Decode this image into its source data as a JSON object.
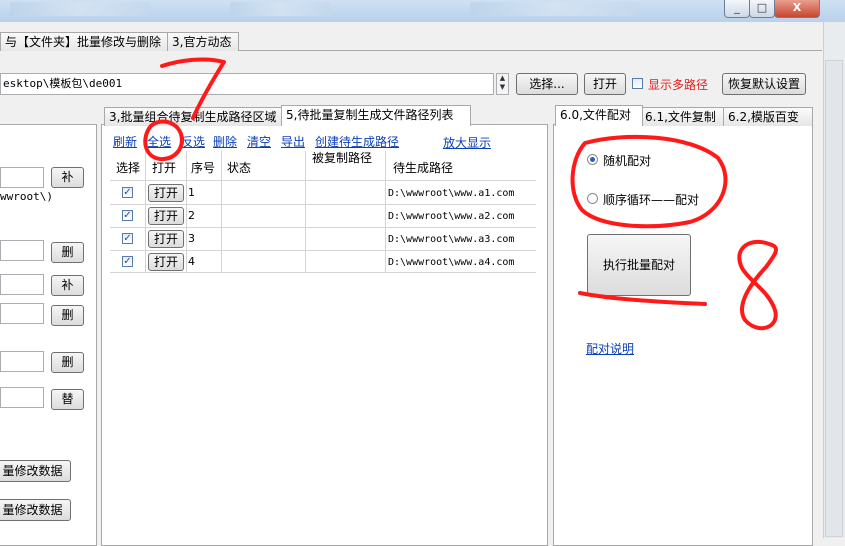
{
  "window": {
    "min": "_",
    "max": "□",
    "close": "X"
  },
  "top_tabs": [
    "与【文件夹】批量修改与删除",
    "3,官方动态"
  ],
  "path_bar": {
    "value": "esktop\\模板包\\de001",
    "select_label": "选择...",
    "open_label": "打开",
    "show_multi_label": "显示多路径",
    "restore_label": "恢复默认设置"
  },
  "left_panel": {
    "path_text": "wwroot\\)",
    "buttons": [
      "补",
      "删",
      "补",
      "删",
      "删",
      "替"
    ],
    "bottom_buttons": [
      "量修改数据",
      "量修改数据"
    ]
  },
  "middle": {
    "tabs": [
      "3,批量组合待复制生成路径区域",
      "5,待批量复制生成文件路径列表"
    ],
    "links": [
      "刷新",
      "全选",
      "反选",
      "删除",
      "清空",
      "导出",
      "创建待生成路径",
      "放大显示"
    ],
    "columns": [
      "选择",
      "打开",
      "序号",
      "状态",
      "被复制路径",
      "待生成路径"
    ],
    "rows": [
      {
        "checked": true,
        "open": "打开",
        "no": "1",
        "status": "",
        "src": "",
        "dest": "D:\\wwwroot\\www.a1.com"
      },
      {
        "checked": true,
        "open": "打开",
        "no": "2",
        "status": "",
        "src": "",
        "dest": "D:\\wwwroot\\www.a2.com"
      },
      {
        "checked": true,
        "open": "打开",
        "no": "3",
        "status": "",
        "src": "",
        "dest": "D:\\wwwroot\\www.a3.com"
      },
      {
        "checked": true,
        "open": "打开",
        "no": "4",
        "status": "",
        "src": "",
        "dest": "D:\\wwwroot\\www.a4.com"
      }
    ]
  },
  "right": {
    "tabs": [
      "6.0,文件配对",
      "6.1,文件复制",
      "6.2,模版百变"
    ],
    "radio_random": "随机配对",
    "radio_sequential": "顺序循环——配对",
    "execute": "执行批量配对",
    "help_link": "配对说明"
  },
  "annotations": {
    "seven": "7",
    "eight": "8",
    "ink_color": "#ff1a1a"
  }
}
